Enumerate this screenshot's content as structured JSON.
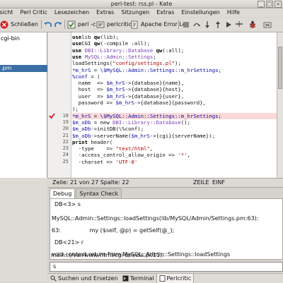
{
  "window": {
    "title": "perl-test: rss.pl - Kate"
  },
  "menu": [
    "Ansicht",
    "Perl Critic",
    "Lesezeichen",
    "Extras",
    "Sitzungen",
    "Extras",
    "Einstellungen",
    "Hilfe"
  ],
  "toolbar": {
    "close_label": "Schließen",
    "perl_c_label": "perl -c",
    "perlcritic_label": "perlcritic",
    "apache_label": "Apache Error Log"
  },
  "filelist": {
    "items": [
      "cgi-bin",
      "",
      "",
      "",
      ".pm"
    ]
  },
  "editor": {
    "lines": [
      {
        "num": "",
        "segs": [
          [
            "kw",
            "use"
          ],
          [
            "",
            "lib "
          ],
          [
            "kw",
            "qw"
          ],
          [
            "",
            "(lib);"
          ]
        ]
      },
      {
        "num": "",
        "segs": [
          [
            "kw",
            "use"
          ],
          [
            "",
            "CGI "
          ],
          [
            "kw",
            "qw"
          ],
          [
            "",
            "(-compile :all);"
          ]
        ]
      },
      {
        "num": "",
        "segs": [
          [
            "kw",
            "use"
          ],
          [
            "cls",
            " DBI::Library::Database "
          ],
          [
            "kw",
            "qw"
          ],
          [
            "",
            "(:all);"
          ]
        ]
      },
      {
        "num": "",
        "segs": [
          [
            "kw",
            "use"
          ],
          [
            "cls",
            " MySQL::Admin::Settings"
          ],
          [
            "",
            ";"
          ]
        ]
      },
      {
        "num": "",
        "segs": [
          [
            "",
            "loadSettings("
          ],
          [
            "str",
            "\"config/settings.pl\""
          ],
          [
            "",
            ");"
          ]
        ]
      },
      {
        "num": "",
        "segs": [
          [
            "var",
            "*m_hrS"
          ],
          [
            "",
            " = "
          ],
          [
            "var",
            "\\$MySQL::Admin::Settings::m_hrSettings"
          ],
          [
            "",
            ";"
          ]
        ]
      },
      {
        "num": "",
        "segs": [
          [
            "var",
            "%conf"
          ],
          [
            "",
            " = ("
          ]
        ]
      },
      {
        "num": "",
        "segs": [
          [
            "",
            "  name  => "
          ],
          [
            "var",
            "$m_hrS"
          ],
          [
            "",
            "->{database}{name},"
          ]
        ]
      },
      {
        "num": "",
        "segs": [
          [
            "",
            "  host  => "
          ],
          [
            "var",
            "$m_hrS"
          ],
          [
            "",
            "->{database}{host},"
          ]
        ]
      },
      {
        "num": "",
        "segs": [
          [
            "",
            "  user  => "
          ],
          [
            "var",
            "$m_hrS"
          ],
          [
            "",
            "->{database}{user},"
          ]
        ]
      },
      {
        "num": "",
        "segs": [
          [
            "",
            "  password => "
          ],
          [
            "var",
            "$m_hrS"
          ],
          [
            "",
            "->{database}{password},"
          ]
        ]
      },
      {
        "num": "",
        "segs": [
          [
            "",
            ");"
          ]
        ]
      },
      {
        "num": "18",
        "segs": [
          [
            "var",
            "*m_hrS"
          ],
          [
            "",
            " = "
          ],
          [
            "var",
            "\\$MySQL::Admin::Settings::m_hrSettings"
          ],
          [
            "",
            ";"
          ]
        ],
        "hl": true
      },
      {
        "num": "19",
        "segs": [
          [
            "var",
            "$m_oDb"
          ],
          [
            "",
            " = new "
          ],
          [
            "cls",
            "DBI::Library::Database"
          ],
          [
            "",
            "();"
          ]
        ]
      },
      {
        "num": "20",
        "segs": [
          [
            "var",
            "$m_oDb"
          ],
          [
            "",
            "->initDB(\\%conf);"
          ]
        ]
      },
      {
        "num": "21",
        "segs": [
          [
            "var",
            "$m_oDb"
          ],
          [
            "",
            "->serverName("
          ],
          [
            "var",
            "$m_hrS"
          ],
          [
            "",
            "->{cgi}{serverName});"
          ]
        ]
      },
      {
        "num": "22",
        "segs": [
          [
            "kw",
            "print"
          ],
          [
            "",
            " header("
          ]
        ]
      },
      {
        "num": "23",
        "segs": [
          [
            "",
            "  -type    => "
          ],
          [
            "str",
            "\"text/html\""
          ],
          [
            "",
            ","
          ]
        ]
      },
      {
        "num": "24",
        "segs": [
          [
            "",
            "  -access_control_allow_origin => "
          ],
          [
            "str",
            "'*'"
          ],
          [
            "",
            ","
          ]
        ]
      },
      {
        "num": "25",
        "segs": [
          [
            "",
            "  -charset => "
          ],
          [
            "str",
            "'UTF-8'"
          ]
        ]
      }
    ]
  },
  "status": {
    "pos": "Zeile: 21 von 27 Spalte: 22",
    "mode": "ZEILE",
    "ins": "EINF"
  },
  "tabs": [
    "Debug",
    "Syntax Check"
  ],
  "output": {
    "lines": [
      "DB<3> s",
      "MySQL::Admin::Settings::loadSettings(lib/MySQL/Admin/Settings.pm:63):",
      "63:                my ($self, @p) = getSelf(@_);",
      "DB<21> r",
      "void context return from MySQL::Admin::Settings::loadSettings",
      "main::(/var/www/html/cgi-bin/rss.pl:11):"
    ]
  },
  "command": {
    "value": "s"
  },
  "bottom_tabs": [
    "Suchen und Ersetzen",
    "Terminal",
    "Perlcritic"
  ]
}
